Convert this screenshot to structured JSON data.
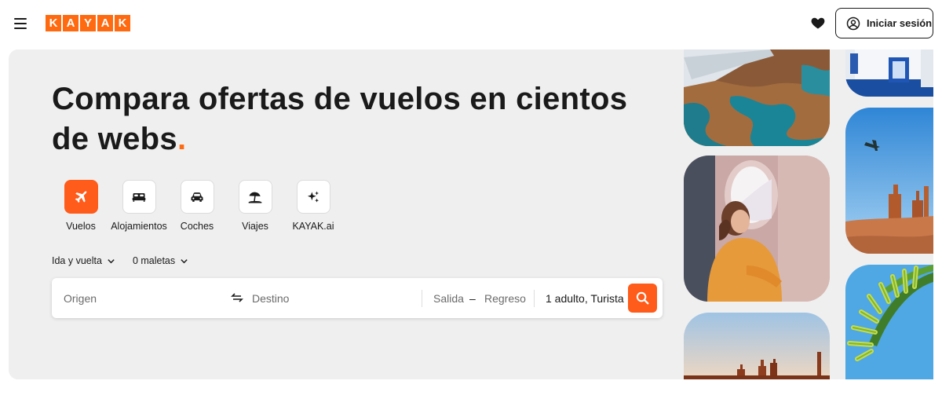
{
  "header": {
    "menu_icon": "hamburger-menu-icon",
    "logo_letters": [
      "K",
      "A",
      "Y",
      "A",
      "K"
    ],
    "favorites_icon": "heart-icon",
    "signin_label": "Iniciar sesión",
    "signin_icon": "user-circle-icon"
  },
  "hero": {
    "headline": "Compara ofertas de vuelos en cientos de webs",
    "headline_dot": ".",
    "verticals": [
      {
        "label": "Vuelos",
        "icon": "airplane-icon",
        "active": true
      },
      {
        "label": "Alojamientos",
        "icon": "bed-icon",
        "active": false
      },
      {
        "label": "Coches",
        "icon": "car-icon",
        "active": false
      },
      {
        "label": "Viajes",
        "icon": "beach-umbrella-icon",
        "active": false
      },
      {
        "label": "KAYAK.ai",
        "icon": "sparkles-icon",
        "active": false
      }
    ],
    "trip_type": "Ida y vuelta",
    "bags": "0 maletas"
  },
  "search": {
    "origin_placeholder": "Origen",
    "destination_placeholder": "Destino",
    "departure_placeholder": "Salida",
    "date_separator": "–",
    "return_placeholder": "Regreso",
    "passengers_value": "1 adulto, Turista",
    "swap_icon": "swap-arrows-icon",
    "search_icon": "search-icon"
  },
  "colors": {
    "brand": "#ff690f",
    "accent": "#ff5b1a",
    "hero_bg": "#efefef",
    "text": "#1a1a1a"
  }
}
